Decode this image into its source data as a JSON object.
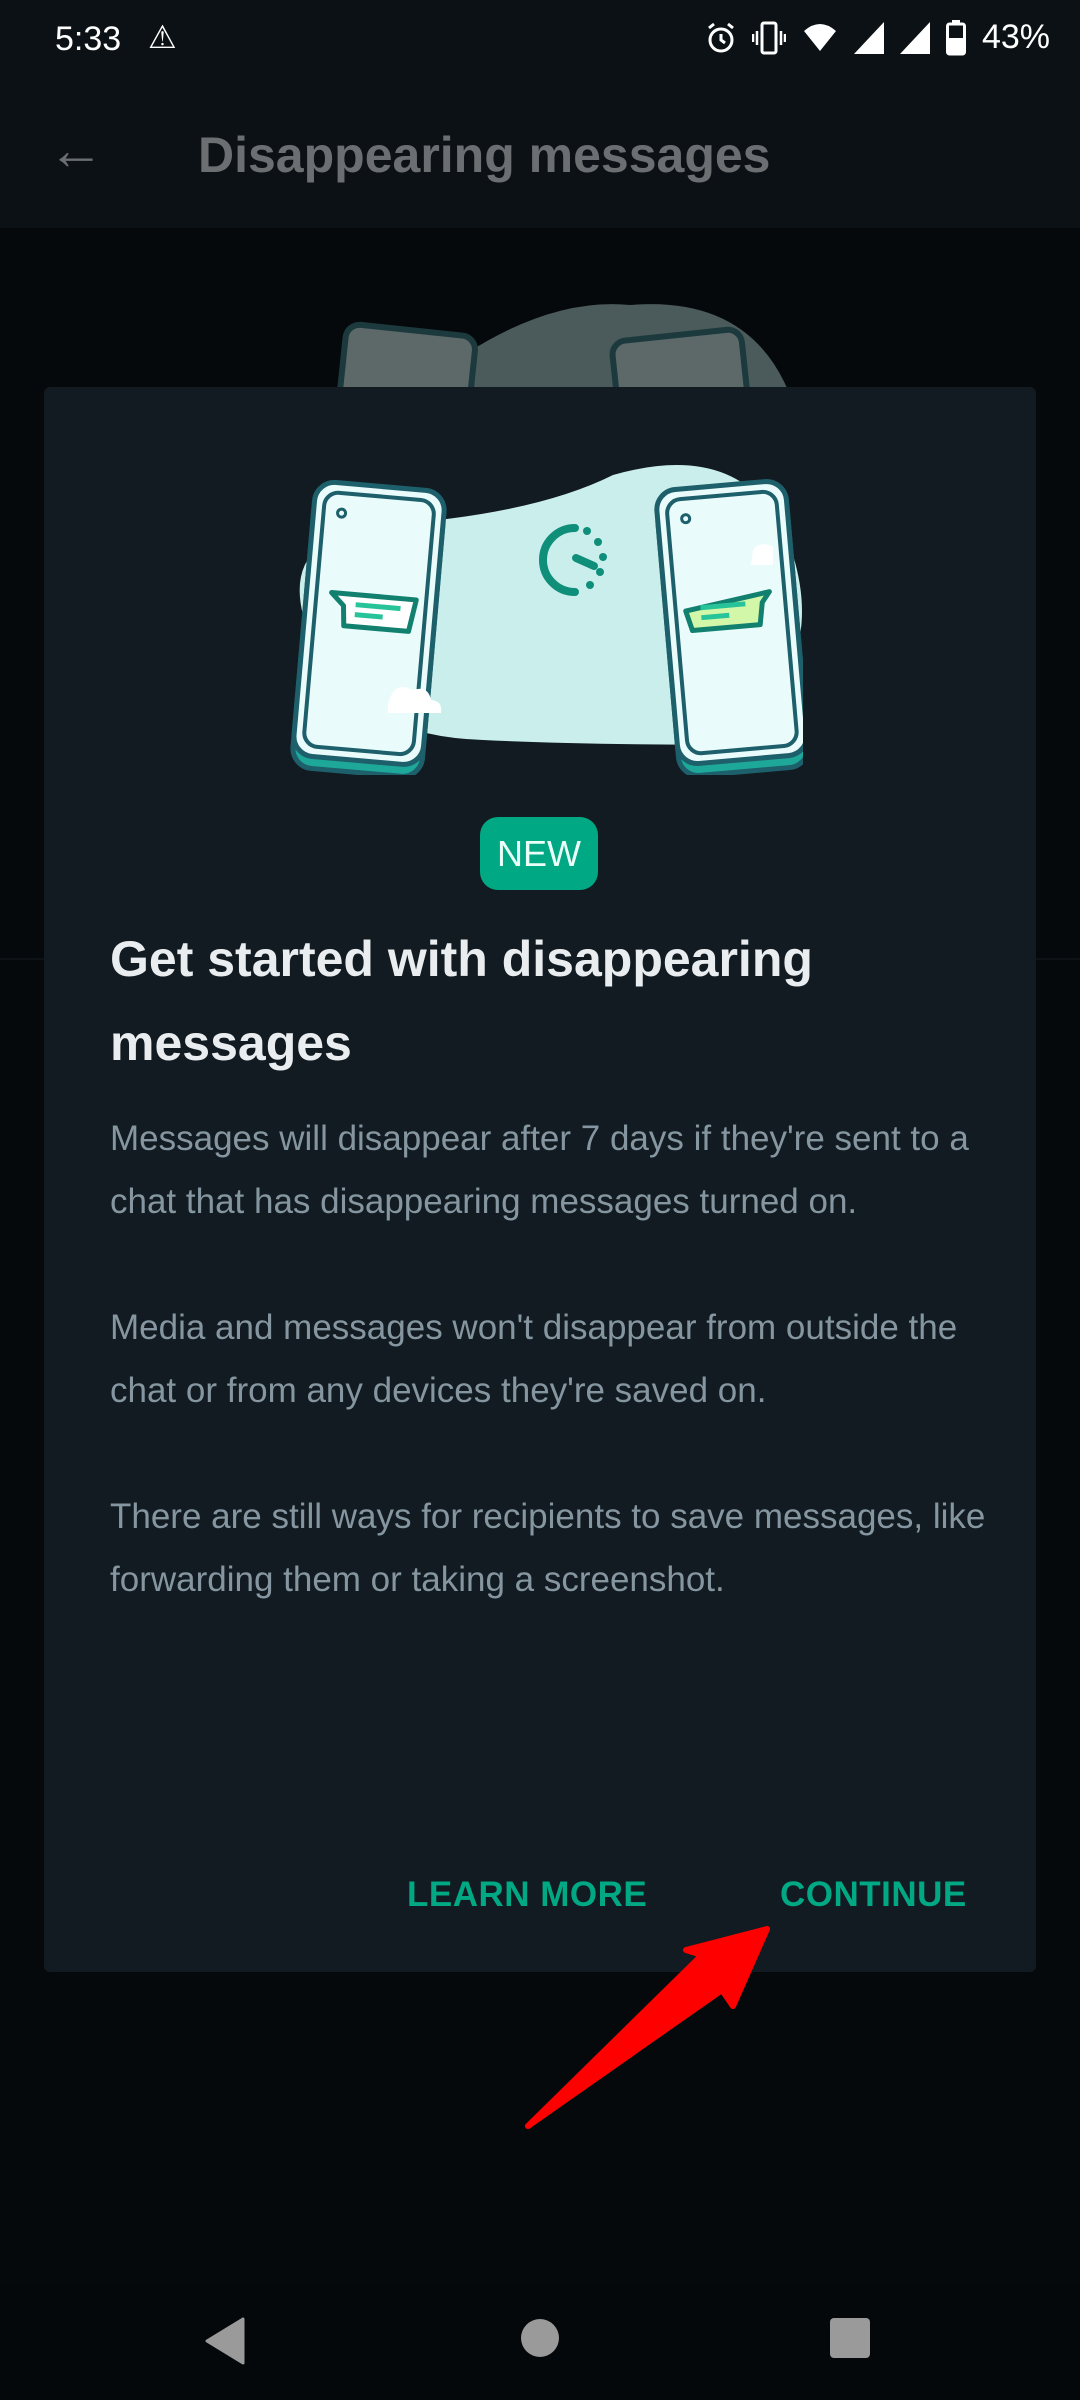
{
  "status_bar": {
    "time": "5:33",
    "battery": "43%",
    "icons": [
      "warning-icon",
      "alarm-icon",
      "vibrate-icon",
      "wifi-icon",
      "signal-icon",
      "signal-icon",
      "battery-icon"
    ]
  },
  "app_bar": {
    "title": "Disappearing messages",
    "back_icon": "arrow-left-icon"
  },
  "dialog": {
    "badge": "NEW",
    "heading": "Get started with disappearing messages",
    "paragraphs": [
      "Messages will disappear after 7 days if they're sent to a chat that has disappearing messages turned on.",
      "Media and messages won't disappear from outside the chat or from any devices they're saved on.",
      "There are still ways for recipients to save messages, like forwarding them or taking a screenshot."
    ],
    "buttons": {
      "learn_more": "LEARN MORE",
      "continue": "CONTINUE"
    }
  },
  "annotation": {
    "type": "red-arrow",
    "points_to": "continue-button",
    "color": "#ff0000"
  },
  "colors": {
    "accent": "#00a884",
    "dialog_bg": "#111b21",
    "heading": "#e9edef",
    "body": "#8696a0"
  },
  "nav_bar": {
    "icons": [
      "nav-back-icon",
      "nav-home-icon",
      "nav-recents-icon"
    ]
  }
}
